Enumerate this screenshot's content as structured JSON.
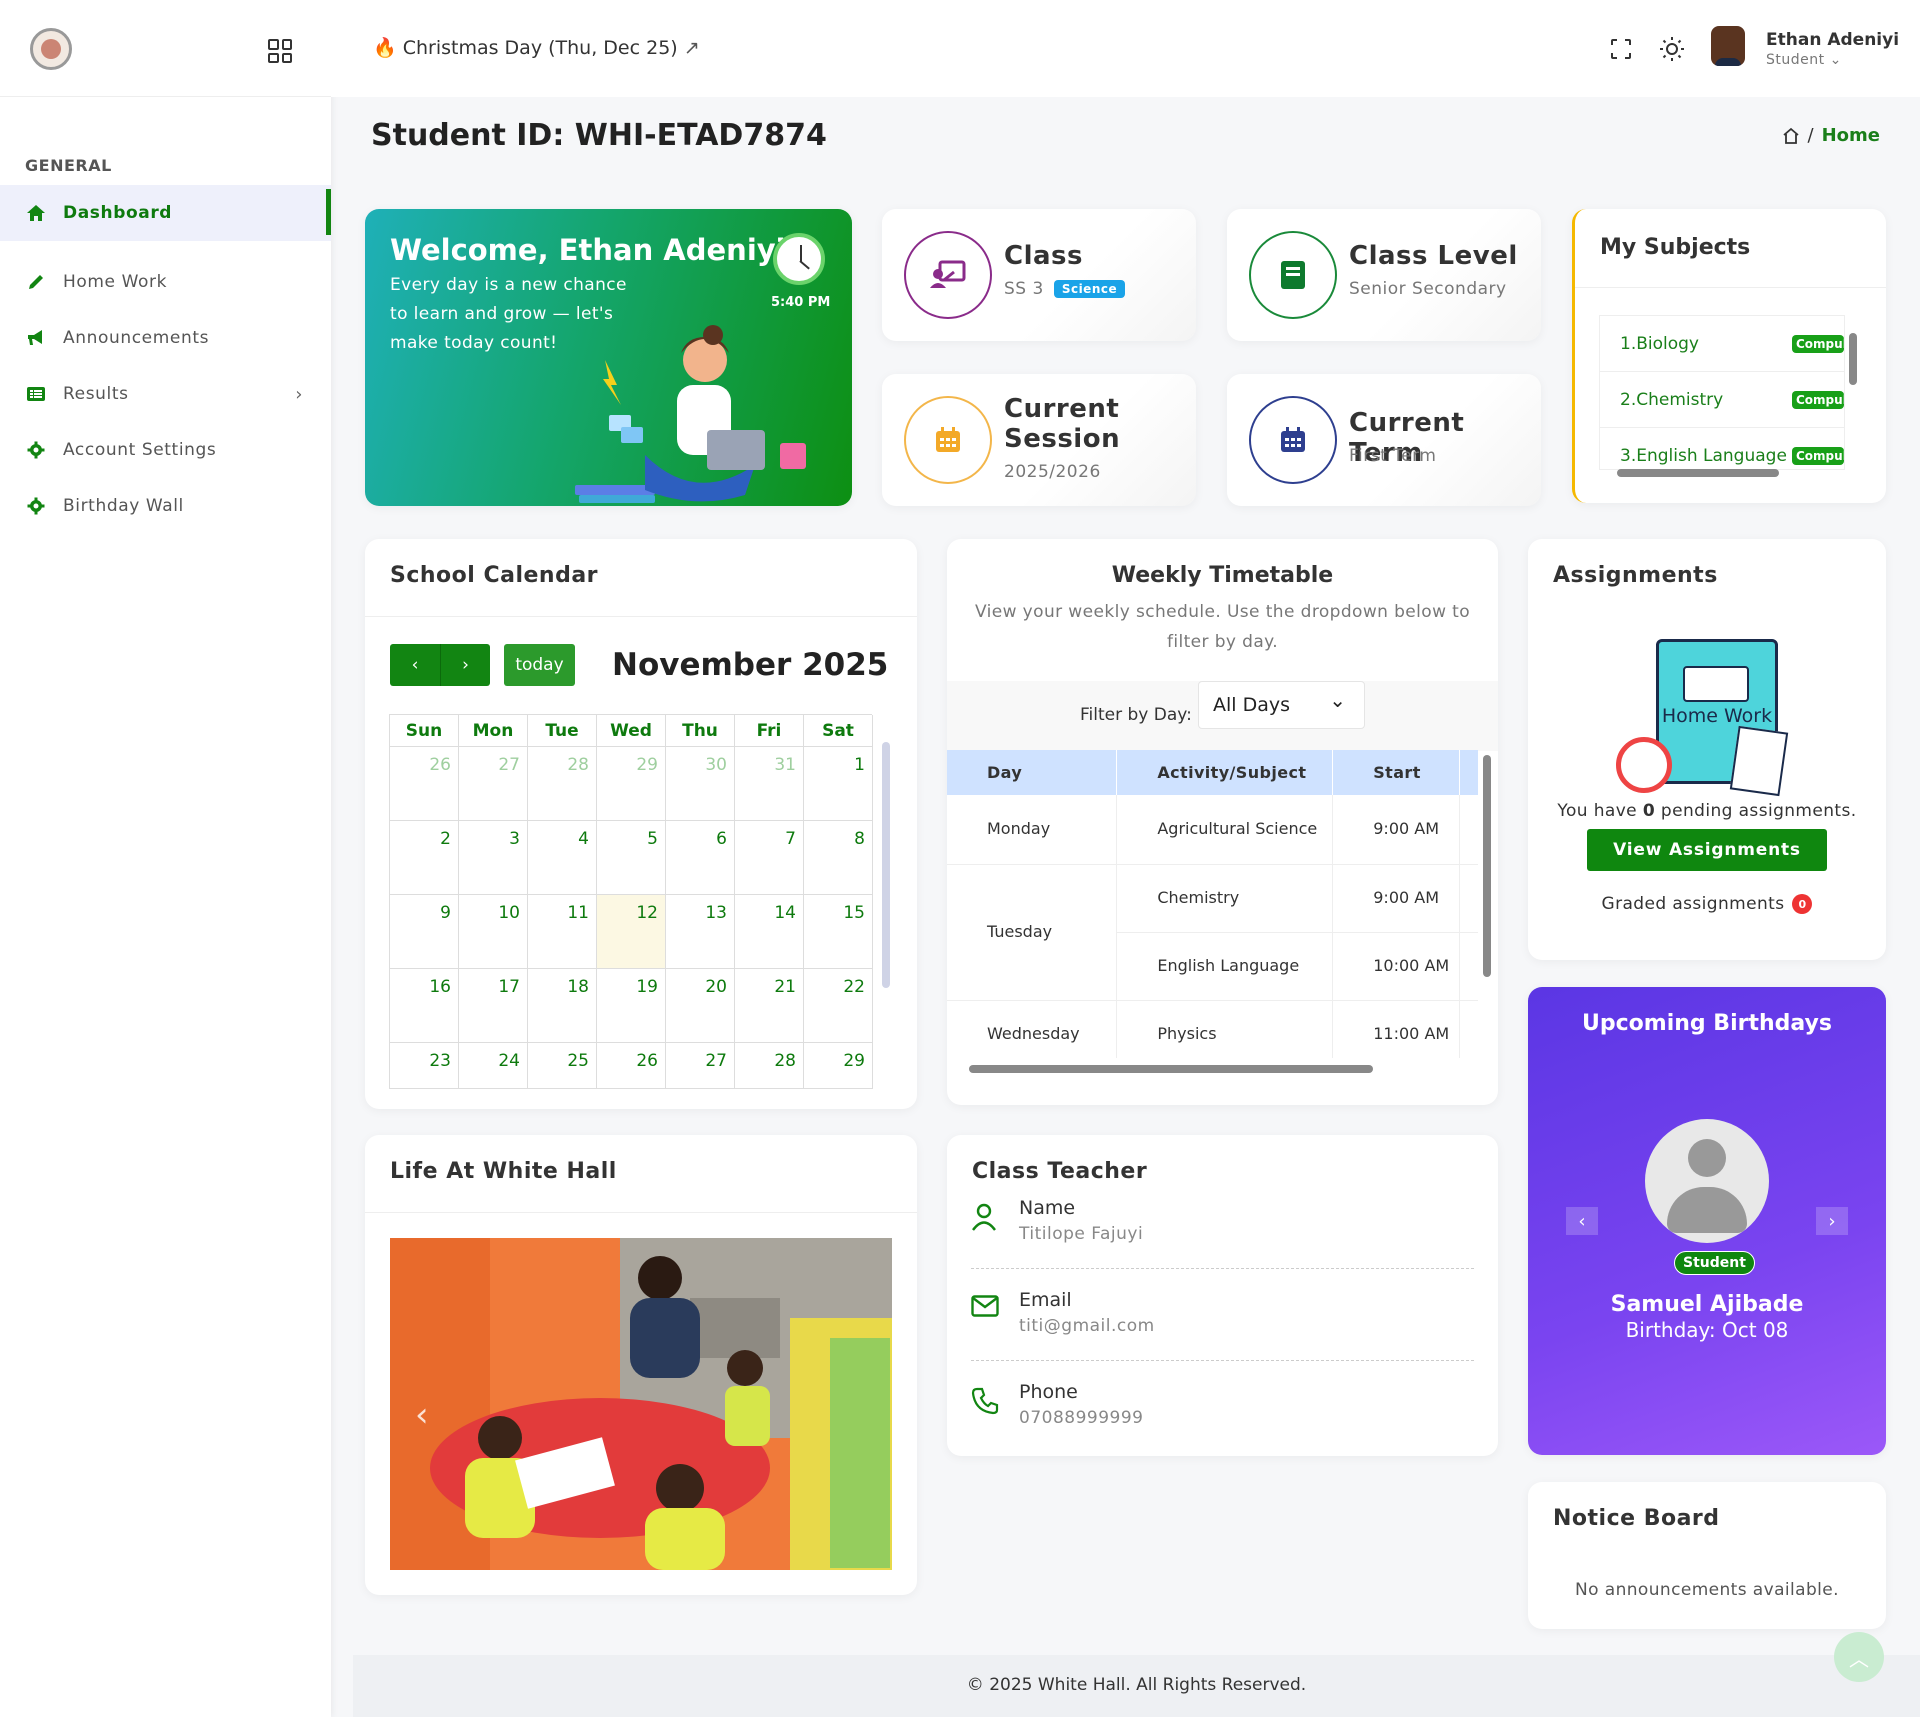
{
  "sidebar": {
    "heading": "GENERAL",
    "items": [
      {
        "label": "Dashboard",
        "icon": "home-icon"
      },
      {
        "label": "Home Work",
        "icon": "pencil-icon"
      },
      {
        "label": "Announcements",
        "icon": "megaphone-icon"
      },
      {
        "label": "Results",
        "icon": "list-icon"
      },
      {
        "label": "Account Settings",
        "icon": "gear-icon"
      },
      {
        "label": "Birthday Wall",
        "icon": "gear-icon"
      }
    ]
  },
  "topbar": {
    "event": "Christmas Day (Thu, Dec 25)",
    "user_name": "Ethan Adeniyi",
    "user_role": "Student"
  },
  "page": {
    "title": "Student ID: WHI-ETAD7874",
    "breadcrumb_sep": "/",
    "breadcrumb_home": "Home"
  },
  "welcome": {
    "title": "Welcome, Ethan Adeniyi",
    "message": "Every day is a new chance to learn and grow — let's make today count!",
    "time": "5:40 PM"
  },
  "cards": {
    "class": {
      "label": "Class",
      "value": "SS 3",
      "badge": "Science"
    },
    "class_level": {
      "label": "Class Level",
      "value": "Senior Secondary"
    },
    "session": {
      "label": "Current Session",
      "value": "2025/2026"
    },
    "term": {
      "label": "Current Term",
      "value": "First Term"
    }
  },
  "subjects": {
    "title": "My Subjects",
    "items": [
      {
        "name": "1.Biology",
        "tag": "Compulsory"
      },
      {
        "name": "2.Chemistry",
        "tag": "Compulsory"
      },
      {
        "name": "3.English Language",
        "tag": "Compulsory"
      }
    ]
  },
  "calendar": {
    "title": "School Calendar",
    "today_label": "today",
    "month": "November 2025",
    "days": [
      "Sun",
      "Mon",
      "Tue",
      "Wed",
      "Thu",
      "Fri",
      "Sat"
    ],
    "weeks": [
      [
        "26",
        "27",
        "28",
        "29",
        "30",
        "31",
        "1"
      ],
      [
        "2",
        "3",
        "4",
        "5",
        "6",
        "7",
        "8"
      ],
      [
        "9",
        "10",
        "11",
        "12",
        "13",
        "14",
        "15"
      ],
      [
        "16",
        "17",
        "18",
        "19",
        "20",
        "21",
        "22"
      ],
      [
        "23",
        "24",
        "25",
        "26",
        "27",
        "28",
        "29"
      ]
    ]
  },
  "timetable": {
    "title": "Weekly Timetable",
    "subtitle": "View your weekly schedule. Use the dropdown below to filter by day.",
    "filter_label": "Filter by Day:",
    "filter_value": "All Days",
    "headers": [
      "Day",
      "Activity/Subject",
      "Start"
    ],
    "rows": [
      {
        "day": "Monday",
        "subject": "Agricultural Science",
        "start": "9:00 AM"
      },
      {
        "day": "Tuesday",
        "subject": "Chemistry",
        "start": "9:00 AM"
      },
      {
        "day": "",
        "subject": "English Language",
        "start": "10:00 AM"
      },
      {
        "day": "Wednesday",
        "subject": "Physics",
        "start": "11:00 AM"
      }
    ]
  },
  "assignments": {
    "title": "Assignments",
    "illustration_text": "Home Work",
    "pending_prefix": "You have",
    "pending_count": "0",
    "pending_suffix": "pending assignments.",
    "button": "View Assignments",
    "graded_label": "Graded assignments",
    "graded_count": "0"
  },
  "birthdays": {
    "title": "Upcoming Birthdays",
    "badge": "Student",
    "name": "Samuel Ajibade",
    "date": "Birthday: Oct 08"
  },
  "life": {
    "title": "Life At White Hall"
  },
  "teacher": {
    "title": "Class Teacher",
    "name_label": "Name",
    "name": "Titilope Fajuyi",
    "email_label": "Email",
    "email": "titi@gmail.com",
    "phone_label": "Phone",
    "phone": "07088999999"
  },
  "notice": {
    "title": "Notice Board",
    "empty": "No announcements available."
  },
  "footer": {
    "text": "© 2025 White Hall. All Rights Reserved."
  },
  "colors": {
    "brand_green": "#128512",
    "accent_purple": "#6b3fea",
    "accent_blue": "#cfe2ff"
  }
}
